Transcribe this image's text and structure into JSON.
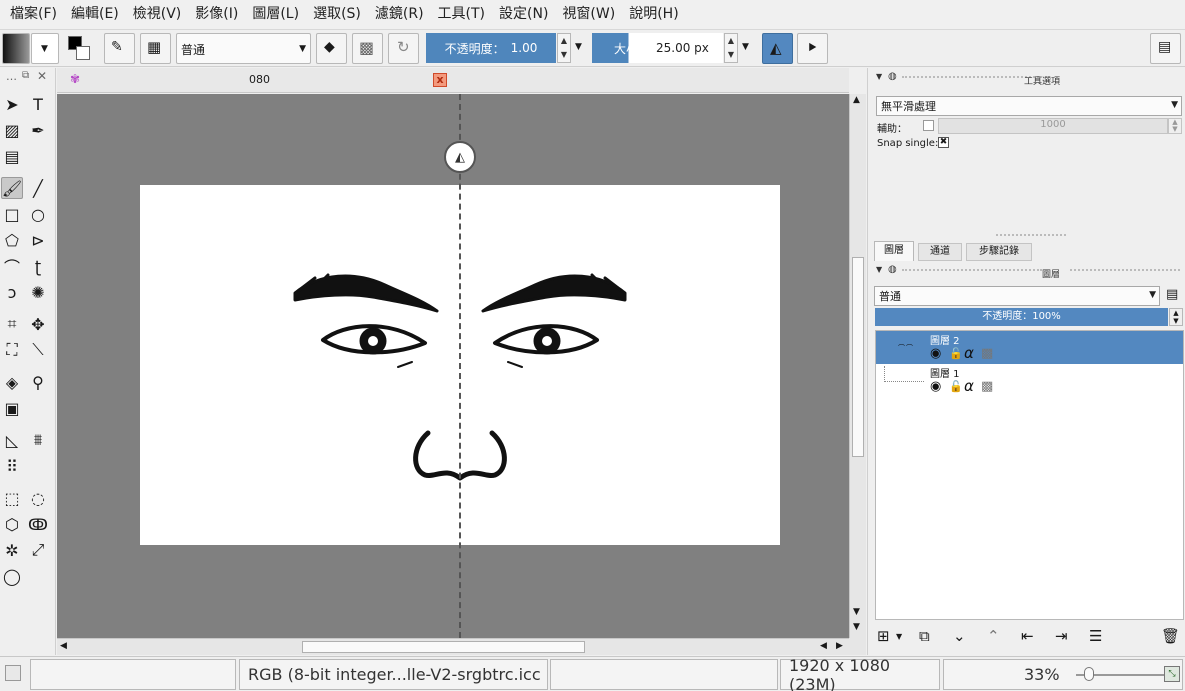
{
  "menu": [
    "檔案(F)",
    "編輯(E)",
    "檢視(V)",
    "影像(I)",
    "圖層(L)",
    "選取(S)",
    "濾鏡(R)",
    "工具(T)",
    "設定(N)",
    "視窗(W)",
    "說明(H)"
  ],
  "tool_options": {
    "blend_mode": "普通",
    "opacity_label": "不透明度：",
    "opacity_value": "1.00",
    "size_label": "大小：",
    "size_value": "25.00 px"
  },
  "document": {
    "tab_title": "080",
    "tab_close": "x"
  },
  "tool_options_docker": {
    "title": "工具選項",
    "smoothing": "無平滑處理",
    "assist_label": "輔助：",
    "assist_value": "1000",
    "snap_label": "Snap single:"
  },
  "layers_docker": {
    "tabs": [
      "圖層",
      "通道",
      "步驟記錄"
    ],
    "title": "圖層",
    "blend_mode": "普通",
    "opacity": "不透明度：100%",
    "layers": [
      {
        "name": "圖層 2",
        "selected": true
      },
      {
        "name": "圖層 1",
        "selected": false
      }
    ]
  },
  "status": {
    "color_profile": "RGB (8-bit integer...lle-V2-srgbtrc.icc",
    "dimensions": "1920 x 1080 (23M)",
    "zoom": "33%"
  },
  "colors": {
    "canvas_bg": "#808080",
    "accent": "#5388c0",
    "close_red": "#f39a7e"
  }
}
